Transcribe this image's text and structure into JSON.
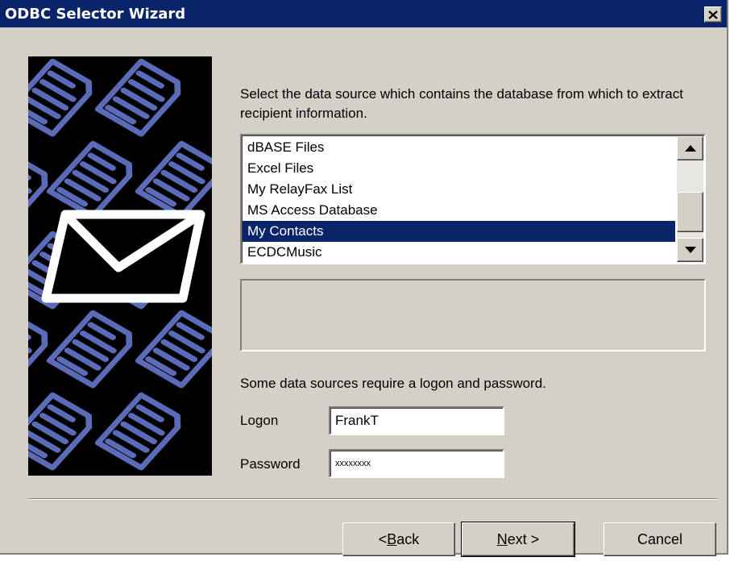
{
  "window": {
    "title": "ODBC Selector Wizard",
    "close_glyph": "✕"
  },
  "prompt": "Select the data source which contains the database from which to extract recipient information.",
  "datasources": {
    "items": [
      "dBASE Files",
      "Excel Files",
      "My RelayFax List",
      "MS Access Database",
      "My Contacts",
      "ECDCMusic"
    ],
    "selected": "My Contacts",
    "scroll_up_icon": "scroll-up-arrow",
    "scroll_down_icon": "scroll-down-arrow"
  },
  "description": "",
  "logon_note": "Some data sources require a logon and password.",
  "logon": {
    "label": "Logon",
    "value": "FrankT"
  },
  "password": {
    "label": "Password",
    "value": "xxxxxxxx"
  },
  "buttons": {
    "back": {
      "pre": "< ",
      "mnemonic": "B",
      "rest": "ack"
    },
    "next": {
      "pre": "",
      "mnemonic": "N",
      "rest": "ext >"
    },
    "cancel": "Cancel"
  },
  "colors": {
    "face": "#d4d0c8",
    "title_bar": "#0a246a",
    "selection": "#0a246a",
    "art_document_blue": "#5c6bb8",
    "art_background": "#000000"
  },
  "art_icons": [
    "document-icon",
    "envelope-icon"
  ]
}
